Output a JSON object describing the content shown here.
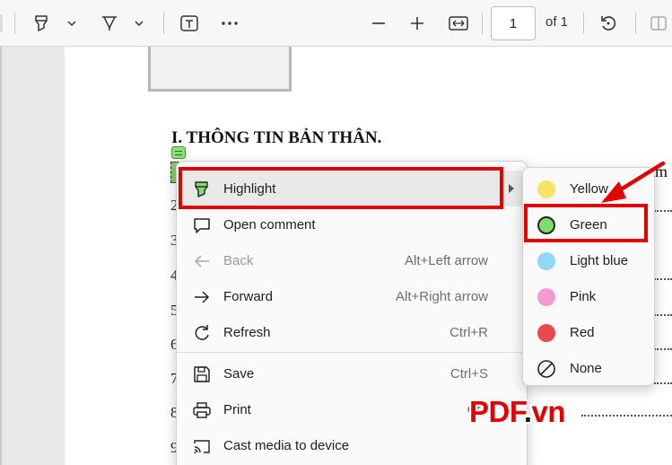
{
  "toolbar": {
    "current_page": "1",
    "page_of": "of 1",
    "icons": [
      "highlighter-icon",
      "chevron-down-icon",
      "pen-icon",
      "chevron-down-icon",
      "text-box-icon",
      "more-icon",
      "zoom-out-icon",
      "zoom-in-icon",
      "fit-width-icon",
      "rotate-icon",
      "page-view-icon"
    ]
  },
  "document": {
    "heading": "I. THÔNG TIN BẢN THÂN.",
    "trailing_text": "m",
    "row_numbers": [
      "2",
      "3",
      "4",
      "5",
      "6",
      "7",
      "8",
      "9"
    ]
  },
  "context_menu": {
    "items": [
      {
        "label": "Highlight",
        "shortcut": "",
        "icon": "highlighter-icon",
        "has_submenu": true
      },
      {
        "label": "Open comment",
        "shortcut": "",
        "icon": "comment-icon"
      },
      {
        "label": "Back",
        "shortcut": "Alt+Left arrow",
        "icon": "arrow-left-icon",
        "disabled": true
      },
      {
        "label": "Forward",
        "shortcut": "Alt+Right arrow",
        "icon": "arrow-right-icon"
      },
      {
        "label": "Refresh",
        "shortcut": "Ctrl+R",
        "icon": "refresh-icon"
      },
      {
        "label": "Save",
        "shortcut": "Ctrl+S",
        "icon": "save-icon"
      },
      {
        "label": "Print",
        "shortcut": "Ctrl",
        "icon": "print-icon"
      },
      {
        "label": "Cast media to device",
        "shortcut": "",
        "icon": "cast-icon"
      }
    ]
  },
  "highlight_submenu": {
    "items": [
      {
        "label": "Yellow",
        "color": "#f7e463"
      },
      {
        "label": "Green",
        "color": "#7fde6b"
      },
      {
        "label": "Light blue",
        "color": "#8fd8f7"
      },
      {
        "label": "Pink",
        "color": "#f49ad0"
      },
      {
        "label": "Red",
        "color": "#e94b4b"
      },
      {
        "label": "None",
        "color": ""
      }
    ]
  },
  "watermark": {
    "brand": "PDF",
    "dot": ".",
    "tld": "vn"
  },
  "colors": {
    "annotation_red": "#e30000",
    "menu_background": "#fafafa"
  }
}
